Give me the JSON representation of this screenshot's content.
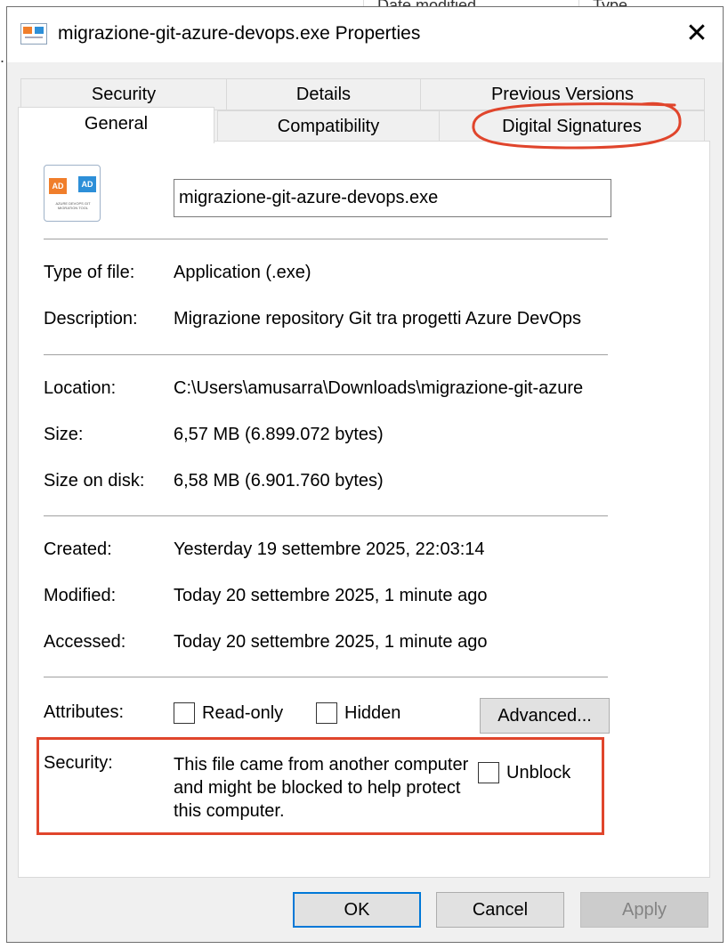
{
  "background": {
    "columns": [
      "Date modified",
      "Type"
    ]
  },
  "window": {
    "title": "migrazione-git-azure-devops.exe Properties",
    "close_glyph": "✕"
  },
  "tabs": {
    "security": "Security",
    "details": "Details",
    "previous_versions": "Previous Versions",
    "general": "General",
    "compatibility": "Compatibility",
    "digital_signatures": "Digital Signatures"
  },
  "file_icon": {
    "left_badge": "AD",
    "right_badge": "AD",
    "caption": "AZURE DEVOPS GIT MIGRATION TOOL",
    "colors": {
      "left": "#f07e2b",
      "right": "#2d8fd8"
    }
  },
  "file": {
    "name": "migrazione-git-azure-devops.exe"
  },
  "properties": {
    "type_label": "Type of file:",
    "type_value": "Application (.exe)",
    "description_label": "Description:",
    "description_value": "Migrazione repository Git tra progetti Azure DevOps",
    "location_label": "Location:",
    "location_value": "C:\\Users\\amusarra\\Downloads\\migrazione-git-azure",
    "size_label": "Size:",
    "size_value": "6,57 MB (6.899.072 bytes)",
    "size_on_disk_label": "Size on disk:",
    "size_on_disk_value": "6,58 MB (6.901.760 bytes)",
    "created_label": "Created:",
    "created_value": "Yesterday 19 settembre 2025, 22:03:14",
    "modified_label": "Modified:",
    "modified_value": "Today 20 settembre 2025, 1 minute ago",
    "accessed_label": "Accessed:",
    "accessed_value": "Today 20 settembre 2025, 1 minute ago"
  },
  "attributes": {
    "label": "Attributes:",
    "read_only": "Read-only",
    "hidden": "Hidden",
    "advanced_button": "Advanced..."
  },
  "security": {
    "label": "Security:",
    "message": "This file came from another computer and might be blocked to help protect this computer.",
    "unblock": "Unblock"
  },
  "buttons": {
    "ok": "OK",
    "cancel": "Cancel",
    "apply": "Apply"
  },
  "colors": {
    "annotation_red": "#e0452c",
    "primary_border": "#0078d7"
  }
}
